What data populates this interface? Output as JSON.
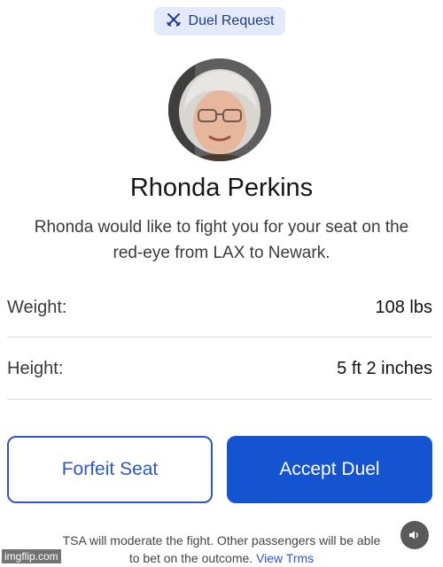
{
  "header": {
    "badge_label": "Duel Request",
    "badge_icon": "crossed-swords-icon"
  },
  "profile": {
    "name": "Rhonda Perkins",
    "message": "Rhonda would like to fight you for your seat on the red-eye from LAX to Newark."
  },
  "stats": [
    {
      "label": "Weight:",
      "value": "108 lbs"
    },
    {
      "label": "Height:",
      "value": "5 ft 2 inches"
    }
  ],
  "actions": {
    "forfeit_label": "Forfeit Seat",
    "accept_label": "Accept Duel"
  },
  "footer": {
    "text": "TSA will moderate the fight. Other passengers will be able to bet on the outcome.",
    "link_text": "View Trms"
  },
  "overlay": {
    "sound_icon": "speaker-icon",
    "watermark": "imgflip.com"
  },
  "colors": {
    "accent": "#1554d1",
    "badge_bg": "#e4eafb",
    "badge_text": "#1e3a8a"
  }
}
